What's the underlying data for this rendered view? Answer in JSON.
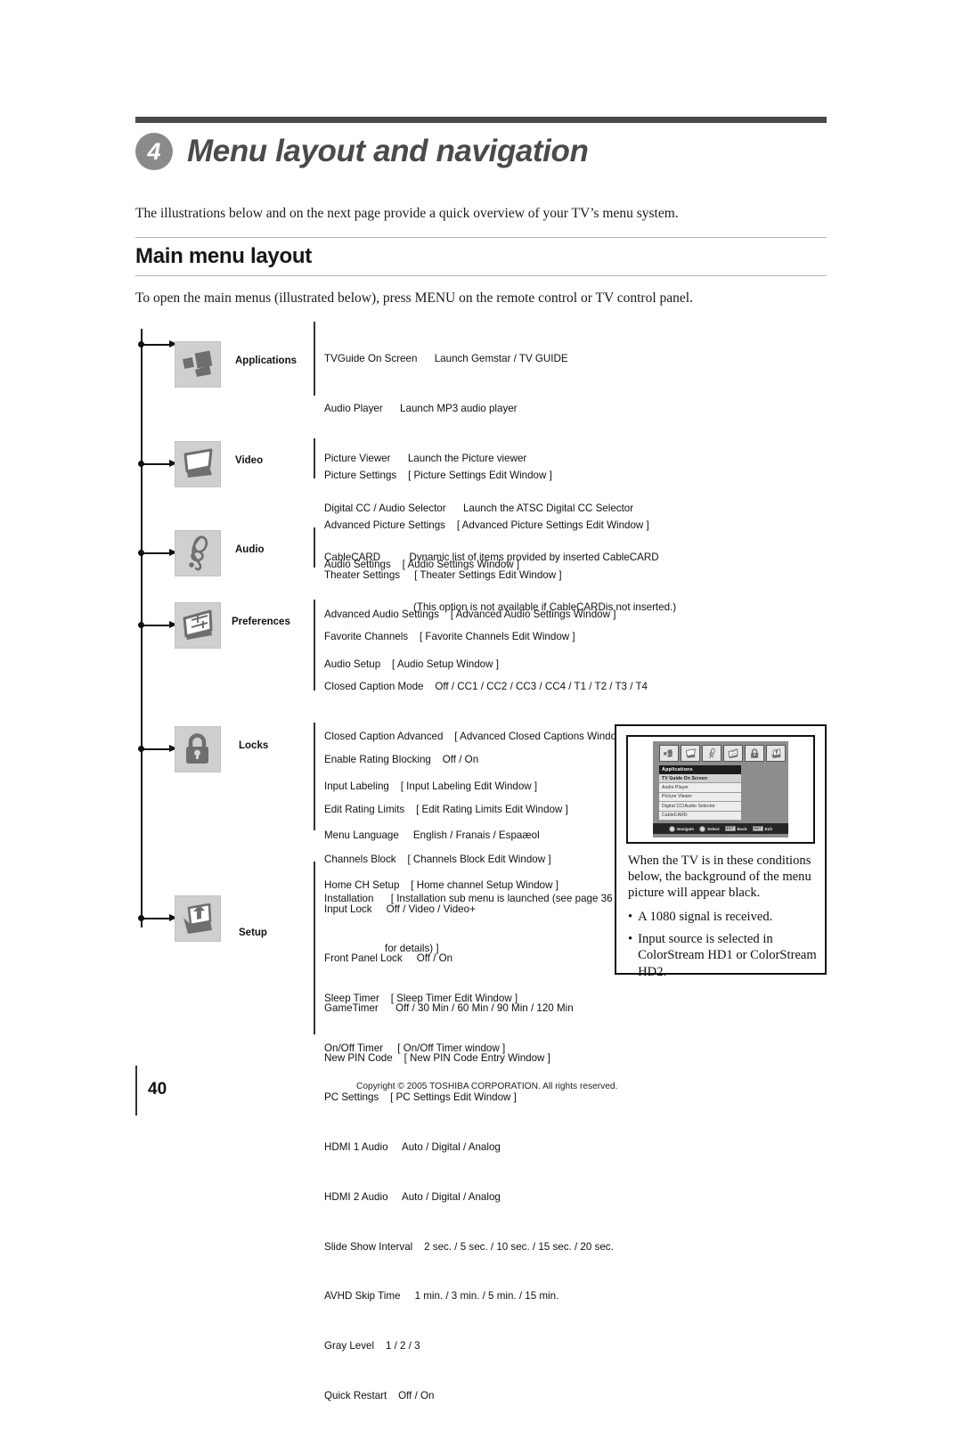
{
  "chapter": {
    "number": "4",
    "title": "Menu layout and navigation"
  },
  "intro": "The illustrations below and on the next page provide a quick overview of your TV’s menu system.",
  "section": {
    "title": "Main menu layout",
    "subintro": "To open the main menus (illustrated below), press MENU on the remote control or TV control panel."
  },
  "diagram": {
    "groups": [
      {
        "label": "Applications",
        "icon": "applications-icon",
        "lines": [
          "TVGuide On Screen      Launch Gemstar / TV GUIDE",
          "Audio Player      Launch MP3 audio player",
          "Picture Viewer      Launch the Picture viewer",
          "Digital CC / Audio Selector      Launch the ATSC Digital CC Selector",
          "CableCARD          Dynamic list of items provided by inserted CableCARD",
          "(This option is not available if CableCARDis not inserted.)"
        ]
      },
      {
        "label": "Video",
        "icon": "video-icon",
        "lines": [
          "Picture Settings    [ Picture Settings Edit Window ]",
          "Advanced Picture Settings    [ Advanced Picture Settings Edit Window ]",
          "Theater Settings     [ Theater Settings Edit Window ]"
        ]
      },
      {
        "label": "Audio",
        "icon": "audio-icon",
        "lines": [
          "Audio Settings    [ Audio Settings Window ]",
          "Advanced Audio Settings    [ Advanced Audio Settings Window ]",
          "Audio Setup    [ Audio Setup Window ]"
        ]
      },
      {
        "label": "Preferences",
        "icon": "preferences-icon",
        "lines": [
          "Favorite Channels    [ Favorite Channels Edit Window ]",
          "Closed Caption Mode    Off / CC1 / CC2 / CC3 / CC4 / T1 / T2 / T3 / T4",
          "Closed Caption Advanced    [ Advanced Closed Captions Window ]",
          "Input Labeling    [ Input Labeling Edit Window ]",
          "Menu Language     English / Franais / Espaæol",
          "Home CH Setup    [ Home channel Setup Window ]"
        ]
      },
      {
        "label": "Locks",
        "icon": "locks-icon",
        "lines": [
          "Enable Rating Blocking    Off / On",
          "Edit Rating Limits    [ Edit Rating Limits Edit Window ]",
          "Channels Block    [ Channels Block Edit Window ]",
          "Input Lock     Off / Video / Video+",
          "Front Panel Lock     Off / On",
          "GameTimer      Off / 30 Min / 60 Min / 90 Min / 120 Min",
          "New PIN Code    [ New PIN Code Entry Window ]"
        ]
      },
      {
        "label": "Setup",
        "icon": "setup-icon",
        "lines": [
          "Installation      [ Installation sub menu is launched (see page 36",
          "for details) ]",
          "Sleep Timer    [ Sleep Timer Edit Window ]",
          "On/Off Timer     [ On/Off Timer window ]",
          "PC Settings    [ PC Settings Edit Window ]",
          "HDMI 1 Audio     Auto / Digital / Analog",
          "HDMI 2 Audio     Auto / Digital / Analog",
          "Slide Show Interval    2 sec. / 5 sec. / 10 sec. / 15 sec. / 20 sec.",
          "AVHD Skip Time     1 min. / 3 min. / 5 min. / 15 min.",
          "Gray Level    1 / 2 / 3",
          "Quick Restart    Off / On"
        ]
      }
    ]
  },
  "callout": {
    "tv": {
      "menu_title": "Applications",
      "items": [
        "TV Guide On Screen",
        "Audio Player",
        "Picture Viewer",
        "Digital CC/Audio Selector",
        "CableCARD"
      ],
      "status": [
        {
          "key": "round",
          "key_label": "",
          "label": "Navigate"
        },
        {
          "key": "round",
          "key_label": "",
          "label": "Select"
        },
        {
          "key": "rect",
          "key_label": "EXIT",
          "label": "Back"
        },
        {
          "key": "rect",
          "key_label": "EXIT",
          "label": "Exit"
        }
      ]
    },
    "paragraph": "When the TV is in these conditions below, the background of the menu picture will appear black.",
    "bullets": [
      "A 1080 signal is received.",
      "Input source is selected in ColorStream HD1 or ColorStream HD2."
    ]
  },
  "footer": {
    "page_number": "40",
    "copyright": "Copyright © 2005 TOSHIBA CORPORATION. All rights reserved."
  }
}
